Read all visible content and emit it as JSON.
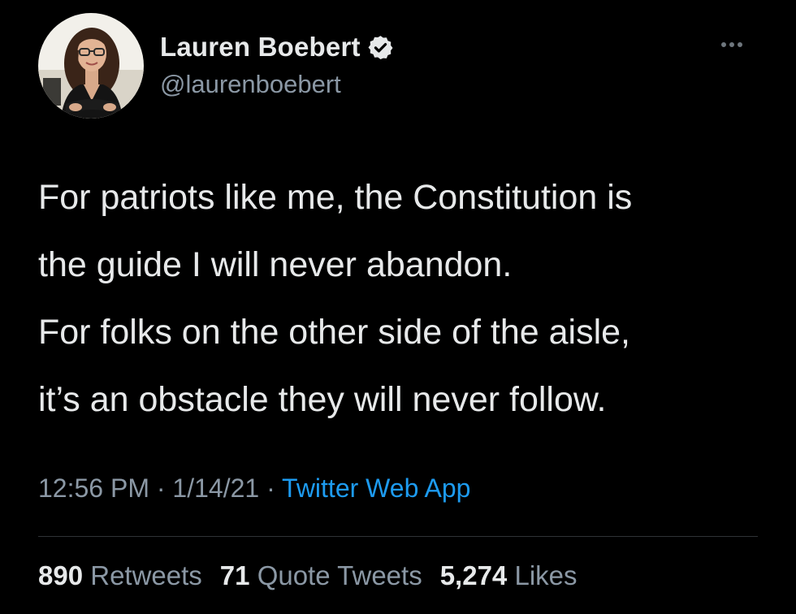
{
  "author": {
    "display_name": "Lauren Boebert",
    "handle": "@laurenboebert",
    "verified": true
  },
  "tweet": {
    "paragraphs": [
      "For patriots like me, the Constitution is the guide I will never abandon.",
      "For folks on the other side of the aisle, it’s an obstacle they will never follow."
    ],
    "lines": [
      "For patriots like me, the Constitution is",
      "the guide I will never abandon.",
      "For folks on the other side of the aisle,",
      "it’s an obstacle they will never follow."
    ],
    "time": "12:56 PM",
    "date": "1/14/21",
    "separator": "·",
    "source": "Twitter Web App"
  },
  "stats": {
    "retweets_count": "890",
    "retweets_label": "Retweets",
    "quotes_count": "71",
    "quotes_label": "Quote Tweets",
    "likes_count": "5,274",
    "likes_label": "Likes"
  },
  "icons": {
    "verified": "verified-badge-icon",
    "more": "more-options-icon"
  },
  "colors": {
    "background": "#000000",
    "text_primary": "#e7e9ea",
    "text_secondary": "#8b98a5",
    "link": "#1d9bf0",
    "divider": "#2f3336"
  }
}
